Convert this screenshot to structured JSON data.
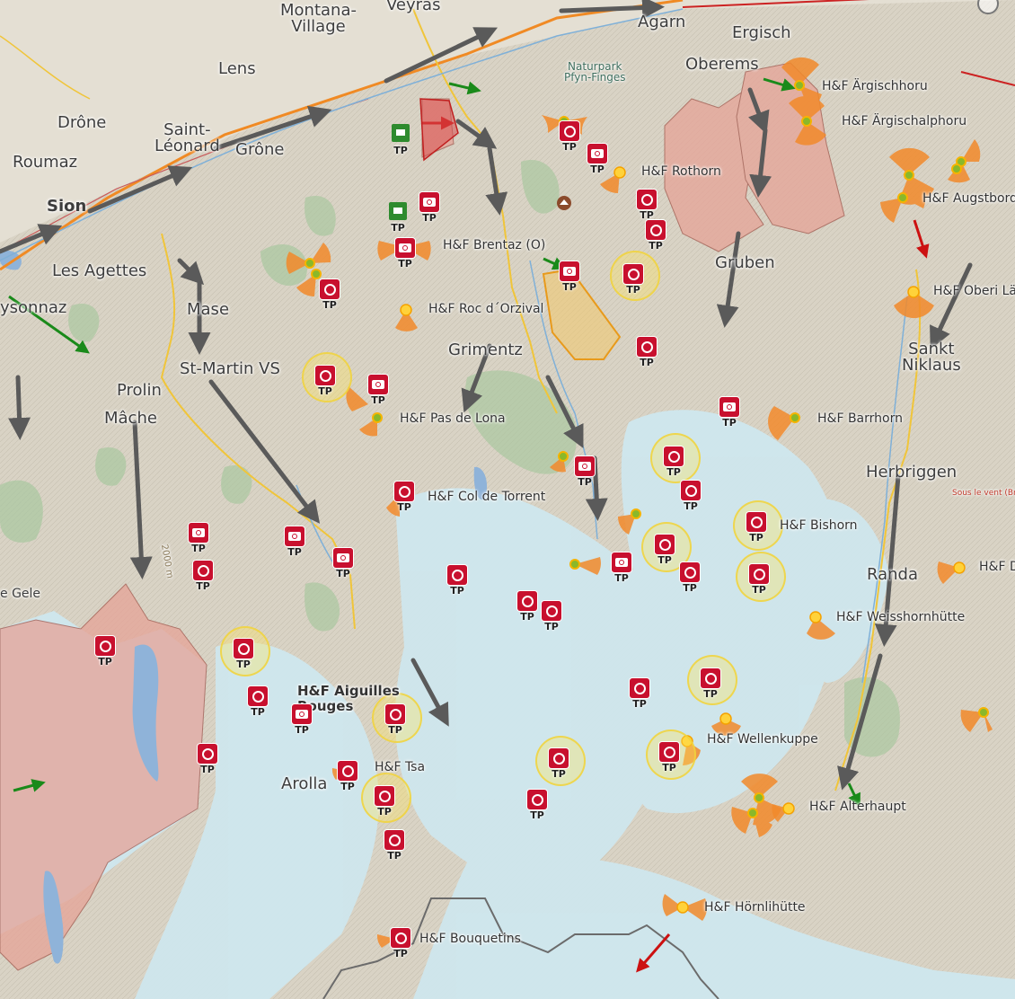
{
  "map": {
    "colors": {
      "terrain": "#d8d2c4",
      "glacier": "#cfe8ee",
      "forest": "#a9c8a0",
      "reserve": "#e3a69b",
      "tp_marker": "#c8102e",
      "takeoff": "#f5a640",
      "wind_arrow": "#555555",
      "highway": "#f08a24"
    },
    "places": [
      {
        "id": "montana",
        "text": "Montana-\nVillage"
      },
      {
        "id": "veyras",
        "text": "Veyras"
      },
      {
        "id": "agarn",
        "text": "Agarn"
      },
      {
        "id": "ergisch",
        "text": "Ergisch"
      },
      {
        "id": "oberems",
        "text": "Oberems"
      },
      {
        "id": "lens",
        "text": "Lens"
      },
      {
        "id": "drone",
        "text": "Drône"
      },
      {
        "id": "saint_leonard",
        "text": "Saint-\nLéonard"
      },
      {
        "id": "grone",
        "text": "Grône"
      },
      {
        "id": "roumaz",
        "text": "Roumaz"
      },
      {
        "id": "sion",
        "text": "Sion"
      },
      {
        "id": "naturpark",
        "text": "Naturpark\nPfyn-Finges"
      },
      {
        "id": "les_agettes",
        "text": "Les Agettes"
      },
      {
        "id": "mase",
        "text": "Mase"
      },
      {
        "id": "vex",
        "text": "ysonnaz"
      },
      {
        "id": "st_martin",
        "text": "St-Martin VS"
      },
      {
        "id": "prolin",
        "text": "Prolin"
      },
      {
        "id": "mache",
        "text": "Mâche"
      },
      {
        "id": "grimentz",
        "text": "Grimentz"
      },
      {
        "id": "gruben",
        "text": "Gruben"
      },
      {
        "id": "sankt_niklaus",
        "text": "Sankt\nNiklaus"
      },
      {
        "id": "herbriggen",
        "text": "Herbriggen"
      },
      {
        "id": "randa",
        "text": "Randa"
      },
      {
        "id": "arolla",
        "text": "Arolla"
      },
      {
        "id": "gele",
        "text": "e Gele"
      },
      {
        "id": "contour",
        "text": "2000 m"
      },
      {
        "id": "road_note",
        "text": "Sous le vent (Brise de va"
      }
    ],
    "hf_labels": [
      {
        "id": "aergischhoru",
        "text": "H&F Ärgischhoru"
      },
      {
        "id": "aergischalphoru",
        "text": "H&F Ärgischalphoru"
      },
      {
        "id": "rothorn",
        "text": "H&F Rothorn"
      },
      {
        "id": "augstbord",
        "text": "H&F Augstbord"
      },
      {
        "id": "brentaz",
        "text": "H&F Brentaz (O)"
      },
      {
        "id": "oberi",
        "text": "H&F Oberi Lä"
      },
      {
        "id": "roc_orzival",
        "text": "H&F Roc d´Orzival"
      },
      {
        "id": "pas_lona",
        "text": "H&F Pas de Lona"
      },
      {
        "id": "barrhorn",
        "text": "H&F Barrhorn"
      },
      {
        "id": "col_torrent",
        "text": "H&F Col de Torrent"
      },
      {
        "id": "bishorn",
        "text": "H&F Bishorn"
      },
      {
        "id": "h_d",
        "text": "H&F D"
      },
      {
        "id": "weisshornhuette",
        "text": "H&F Weisshornhütte"
      },
      {
        "id": "aiguilles",
        "text": "H&F Aiguilles\nRouges"
      },
      {
        "id": "wellenkuppe",
        "text": "H&F Wellenkuppe"
      },
      {
        "id": "tsa",
        "text": "H&F Tsa"
      },
      {
        "id": "alterhaupt",
        "text": "H&F Alterhaupt"
      },
      {
        "id": "hoernlihuette",
        "text": "H&F Hörnlihütte"
      },
      {
        "id": "bouquetins",
        "text": "H&F Bouquetins"
      }
    ],
    "tp_label": "TP"
  }
}
